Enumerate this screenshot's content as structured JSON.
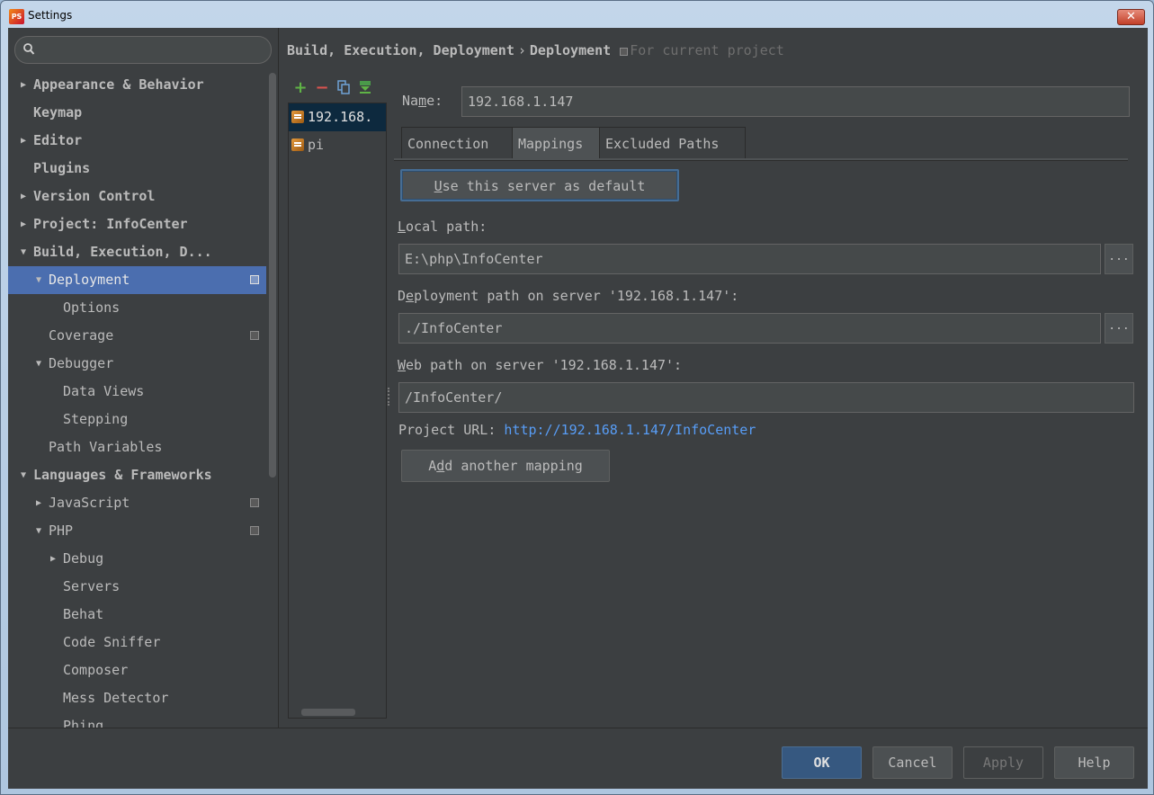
{
  "window": {
    "title": "Settings",
    "close_label": "✕"
  },
  "sidebar": {
    "search": {
      "value": "",
      "placeholder": ""
    },
    "items": [
      {
        "label": "Appearance & Behavior",
        "arrow": "▶",
        "bold": true,
        "level": 0
      },
      {
        "label": "Keymap",
        "arrow": "",
        "bold": true,
        "level": 0
      },
      {
        "label": "Editor",
        "arrow": "▶",
        "bold": true,
        "level": 0
      },
      {
        "label": "Plugins",
        "arrow": "",
        "bold": true,
        "level": 0
      },
      {
        "label": "Version Control",
        "arrow": "▶",
        "bold": true,
        "level": 0
      },
      {
        "label": "Project: InfoCenter",
        "arrow": "▶",
        "bold": true,
        "level": 0
      },
      {
        "label": "Build, Execution, D...",
        "arrow": "▼",
        "bold": true,
        "level": 0
      },
      {
        "label": "Deployment",
        "arrow": "▼",
        "bold": false,
        "level": 1,
        "selected": true,
        "project_icon": true
      },
      {
        "label": "Options",
        "arrow": "",
        "bold": false,
        "level": 2
      },
      {
        "label": "Coverage",
        "arrow": "",
        "bold": false,
        "level": 1,
        "project_icon": true
      },
      {
        "label": "Debugger",
        "arrow": "▼",
        "bold": false,
        "level": 1
      },
      {
        "label": "Data Views",
        "arrow": "",
        "bold": false,
        "level": 2
      },
      {
        "label": "Stepping",
        "arrow": "",
        "bold": false,
        "level": 2
      },
      {
        "label": "Path Variables",
        "arrow": "",
        "bold": false,
        "level": 1
      },
      {
        "label": "Languages & Frameworks",
        "arrow": "▼",
        "bold": true,
        "level": 0
      },
      {
        "label": "JavaScript",
        "arrow": "▶",
        "bold": false,
        "level": 1,
        "project_icon": true
      },
      {
        "label": "PHP",
        "arrow": "▼",
        "bold": false,
        "level": 1,
        "project_icon": true
      },
      {
        "label": "Debug",
        "arrow": "▶",
        "bold": false,
        "level": 2
      },
      {
        "label": "Servers",
        "arrow": "",
        "bold": false,
        "level": 2
      },
      {
        "label": "Behat",
        "arrow": "",
        "bold": false,
        "level": 2
      },
      {
        "label": "Code Sniffer",
        "arrow": "",
        "bold": false,
        "level": 2
      },
      {
        "label": "Composer",
        "arrow": "",
        "bold": false,
        "level": 2
      },
      {
        "label": "Mess Detector",
        "arrow": "",
        "bold": false,
        "level": 2
      },
      {
        "label": "Phing",
        "arrow": "",
        "bold": false,
        "level": 2
      }
    ]
  },
  "breadcrumb": {
    "parent": "Build, Execution, Deployment",
    "separator": "›",
    "current": "Deployment",
    "hint": "For current project"
  },
  "server_toolbar": {
    "add": "+",
    "remove": "−",
    "copy_icon": "copy-icon",
    "default_icon": "set-default-icon"
  },
  "servers": [
    {
      "label": "192.168.",
      "selected": true
    },
    {
      "label": "pi",
      "selected": false
    }
  ],
  "config": {
    "name_label_pre": "Na",
    "name_label_u": "m",
    "name_label_post": "e:",
    "name_value": "192.168.1.147",
    "tabs": [
      "Connection",
      "Mappings",
      "Excluded Paths"
    ],
    "active_tab": "Mappings",
    "use_default_u": "U",
    "use_default_rest": "se this server as default",
    "local_path_u": "L",
    "local_path_rest": "ocal path:",
    "local_path_value": "E:\\php\\InfoCenter",
    "deployment_path_pre": "D",
    "deployment_path_u": "e",
    "deployment_path_rest": "ployment path on server '192.168.1.147':",
    "deployment_path_value": "./InfoCenter",
    "web_path_u": "W",
    "web_path_rest": "eb path on server '192.168.1.147':",
    "web_path_value": "/InfoCenter/",
    "project_url_label": "Project URL:",
    "project_url": "http://192.168.1.147/InfoCenter",
    "add_mapping_pre": "A",
    "add_mapping_u": "d",
    "add_mapping_rest": "d another mapping",
    "browse_label": "..."
  },
  "footer": {
    "ok": "OK",
    "cancel": "Cancel",
    "apply": "Apply",
    "help": "Help"
  },
  "colors": {
    "background": "#3c3f41",
    "selection": "#4b6eaf",
    "link": "#589df6",
    "default_button": "#365880"
  }
}
